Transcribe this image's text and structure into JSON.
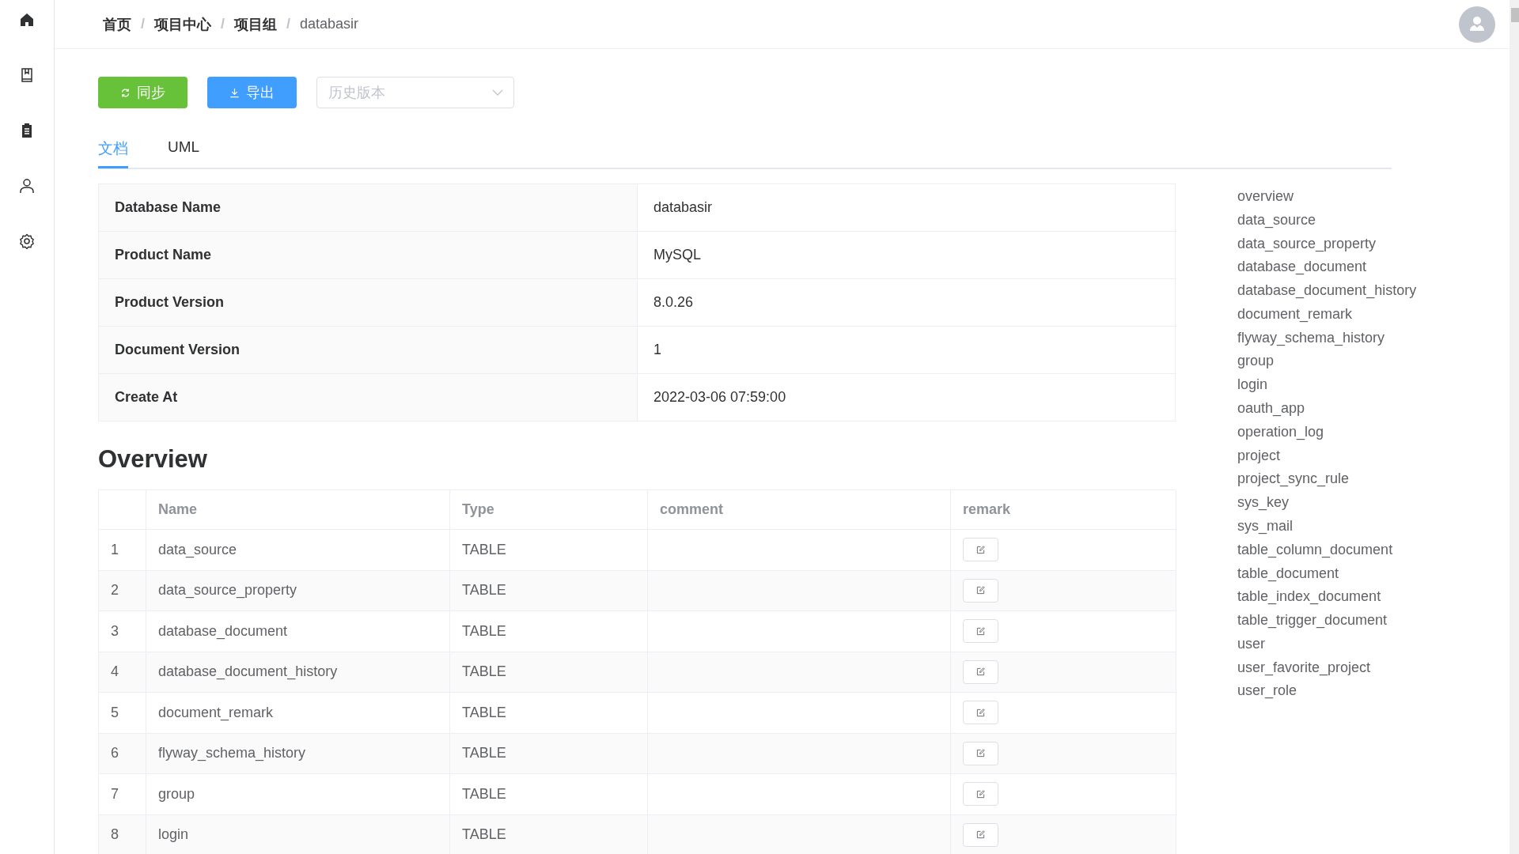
{
  "sidebar": {
    "items": [
      {
        "kind": "home"
      },
      {
        "kind": "book"
      },
      {
        "kind": "clipboard"
      },
      {
        "kind": "user"
      },
      {
        "kind": "settings"
      }
    ]
  },
  "breadcrumb": [
    {
      "label": "首页",
      "current": false
    },
    {
      "label": "项目中心",
      "current": false
    },
    {
      "label": "项目组",
      "current": false
    },
    {
      "label": "databasir",
      "current": true
    }
  ],
  "separator": "/",
  "toolbar": {
    "sync_button": "同步",
    "export_button": "导出",
    "version_select": {
      "placeholder": "历史版本"
    }
  },
  "tabs": [
    {
      "label": "文档",
      "selected": true
    },
    {
      "label": "UML",
      "selected": false
    }
  ],
  "info_table": [
    {
      "label": "Database Name",
      "value": "databasir"
    },
    {
      "label": "Product Name",
      "value": "MySQL"
    },
    {
      "label": "Product Version",
      "value": "8.0.26"
    },
    {
      "label": "Document Version",
      "value": "1"
    },
    {
      "label": "Create At",
      "value": "2022-03-06 07:59:00"
    }
  ],
  "overview": {
    "title": "Overview",
    "columns": [
      "Name",
      "Type",
      "comment",
      "remark"
    ],
    "rows": [
      {
        "index": "1",
        "name": "data_source",
        "type": "TABLE"
      },
      {
        "index": "2",
        "name": "data_source_property",
        "type": "TABLE"
      },
      {
        "index": "3",
        "name": "database_document",
        "type": "TABLE"
      },
      {
        "index": "4",
        "name": "database_document_history",
        "type": "TABLE"
      },
      {
        "index": "5",
        "name": "document_remark",
        "type": "TABLE"
      },
      {
        "index": "6",
        "name": "flyway_schema_history",
        "type": "TABLE"
      },
      {
        "index": "7",
        "name": "group",
        "type": "TABLE"
      },
      {
        "index": "8",
        "name": "login",
        "type": "TABLE"
      }
    ]
  },
  "toc": [
    "overview",
    "data_source",
    "data_source_property",
    "database_document",
    "database_document_history",
    "document_remark",
    "flyway_schema_history",
    "group",
    "login",
    "oauth_app",
    "operation_log",
    "project",
    "project_sync_rule",
    "sys_key",
    "sys_mail",
    "table_column_document",
    "table_document",
    "table_index_document",
    "table_trigger_document",
    "user",
    "user_favorite_project",
    "user_role"
  ]
}
